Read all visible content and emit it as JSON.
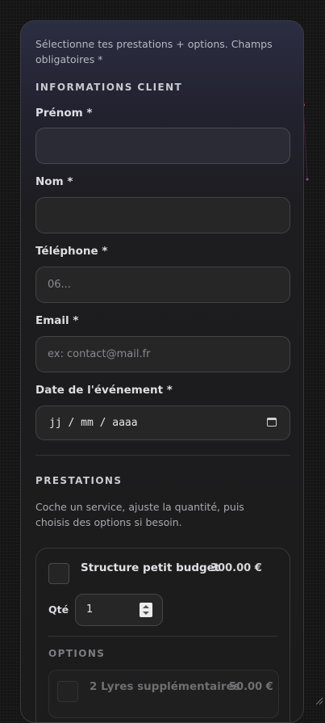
{
  "intro": "Sélectionne tes prestations + options. Champs obligatoires *",
  "client_section": {
    "title": "INFORMATIONS CLIENT",
    "fields": [
      {
        "label": "Prénom *",
        "value": "",
        "placeholder": ""
      },
      {
        "label": "Nom *",
        "value": "",
        "placeholder": ""
      },
      {
        "label": "Téléphone *",
        "value": "",
        "placeholder": "06..."
      },
      {
        "label": "Email *",
        "value": "",
        "placeholder": "ex: contact@mail.fr"
      },
      {
        "label": "Date de l'événement *",
        "value": "jj / mm / aaaa",
        "placeholder": ""
      }
    ]
  },
  "prestations": {
    "title": "PRESTATIONS",
    "description": "Coche un service, ajuste la quantité, puis choisis des options si besoin.",
    "service": {
      "name": "Structure petit budget",
      "price": "300.00 €",
      "checked": false,
      "qty_label": "Qté",
      "qty_value": "1"
    },
    "options_title": "OPTIONS",
    "options": [
      {
        "name": "2 Lyres supplémentaires",
        "price": "50.00 €",
        "checked": false
      }
    ]
  },
  "icons": {
    "date": "calendar-icon",
    "qty": "spinner-icon"
  },
  "colors": {
    "accent": "#9b2f8f",
    "background": "#141414",
    "card": "#1b1b1b"
  }
}
